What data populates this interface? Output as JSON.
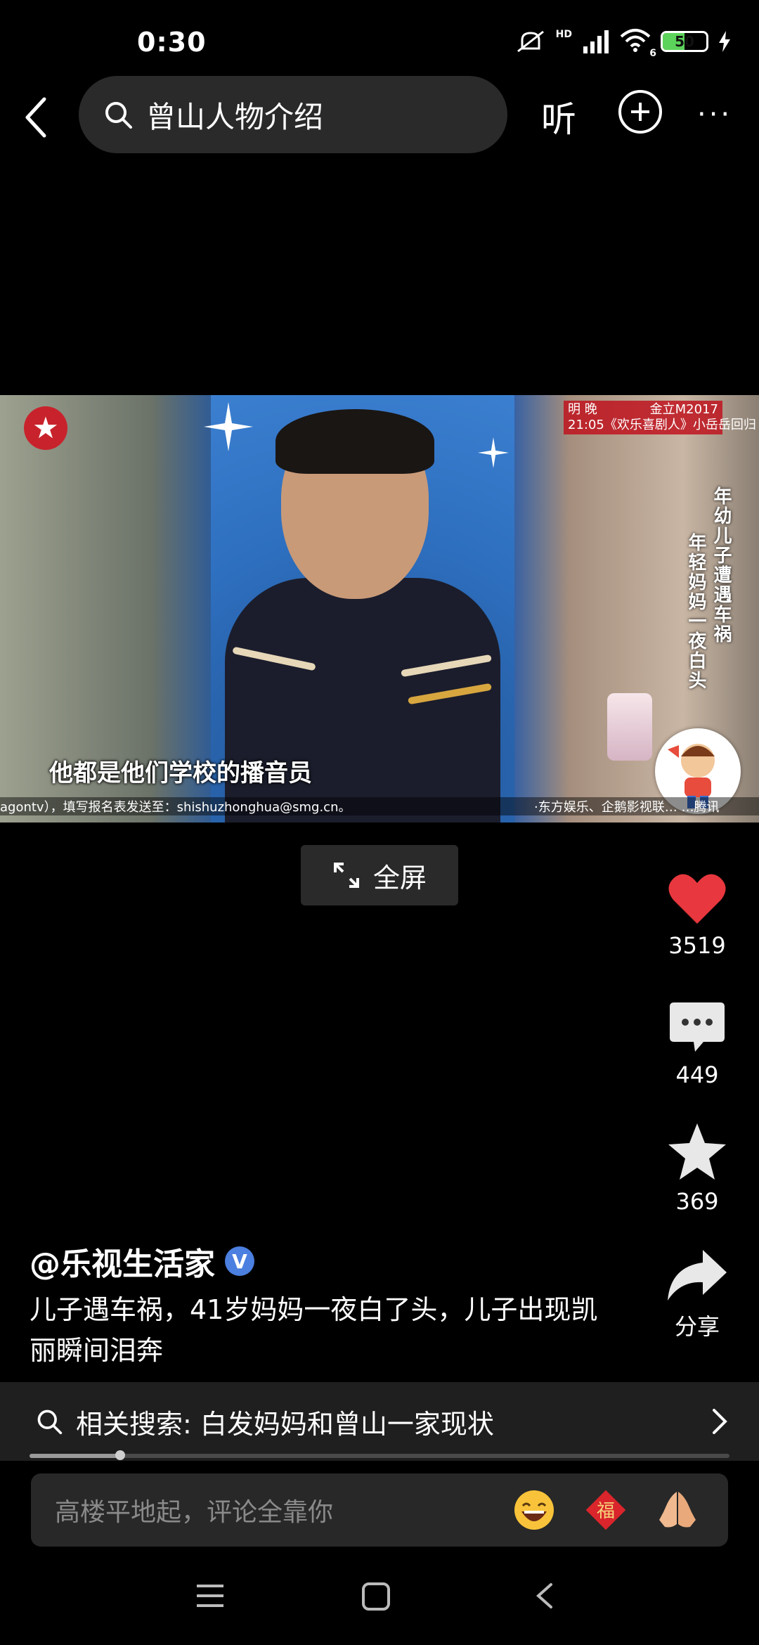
{
  "status_bar": {
    "time": "0:30",
    "hd_label": "HD",
    "wifi_sub": "6",
    "battery": "50",
    "battery_level_percent": 50
  },
  "top_bar": {
    "search_query": "曾山人物介绍",
    "listen_label": "听",
    "more_label": "···"
  },
  "video": {
    "promo_line1_a": "明 晚",
    "promo_line1_b": "金立M2017",
    "promo_line2_a": "21:05",
    "promo_line2_b": "《欢乐喜剧人》小岳岳回归",
    "vertical_caption_1": "年幼儿子遭遇车祸",
    "vertical_caption_2": "年轻妈妈一夜白头",
    "subtitle": "他都是他们学校的播音员",
    "ticker_left": "agontv），填写报名表发送至：shishuzhonghua@smg.cn。",
    "ticker_right": "·东方娱乐、企鹅影视联…        …腾讯"
  },
  "fullscreen_label": "全屏",
  "actions": {
    "like_count": "3519",
    "comment_count": "449",
    "favorite_count": "369",
    "share_label": "分享"
  },
  "author": {
    "name": "@乐视生活家",
    "verified_mark": "V"
  },
  "description": "儿子遇车祸，41岁妈妈一夜白了头，儿子出现凯丽瞬间泪奔",
  "related_search": {
    "label": "相关搜索: 白发妈妈和曾山一家现状"
  },
  "playback": {
    "progress_fraction": 0.13
  },
  "comment_input": {
    "placeholder": "高楼平地起，评论全靠你",
    "fu_label": "福"
  },
  "colors": {
    "background": "#000000",
    "like_red": "#e8373e",
    "panel_gray": "#2a2a2a",
    "verify_blue": "#4b7fe0"
  }
}
